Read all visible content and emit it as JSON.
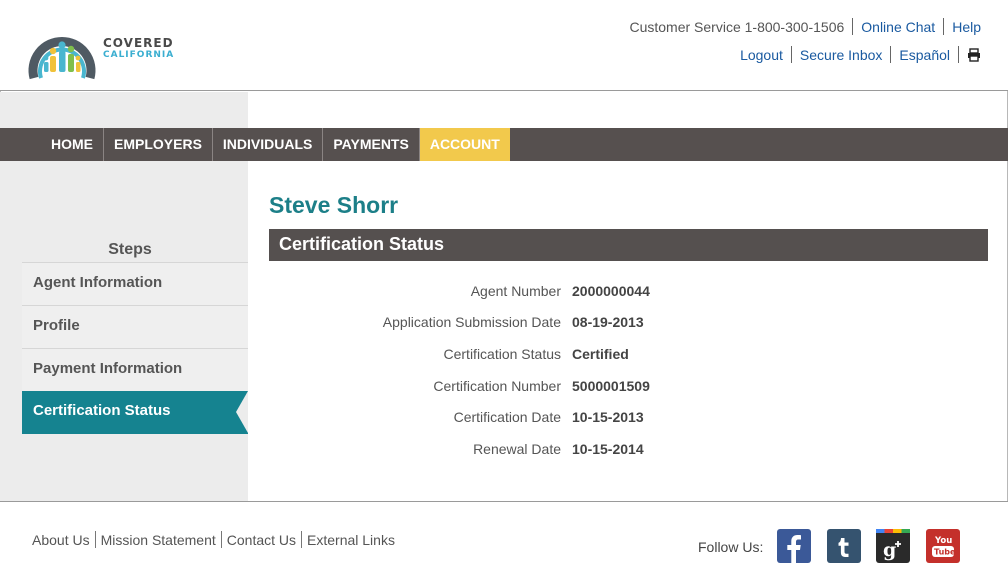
{
  "header": {
    "logo_line1": "COVERED",
    "logo_line2": "CALIFORNIA",
    "customer_service": "Customer Service 1-800-300-1506",
    "online_chat": "Online Chat",
    "help": "Help",
    "logout": "Logout",
    "secure_inbox": "Secure Inbox",
    "espanol": "Español",
    "print_icon": "printer-icon"
  },
  "nav": {
    "items": [
      {
        "label": "HOME"
      },
      {
        "label": "EMPLOYERS"
      },
      {
        "label": "INDIVIDUALS"
      },
      {
        "label": "PAYMENTS"
      },
      {
        "label": "ACCOUNT"
      }
    ],
    "active_index": 4,
    "active_color": "#f2c94c",
    "bar_color": "#56504f"
  },
  "sidebar": {
    "title": "Steps",
    "items": [
      {
        "label": "Agent Information"
      },
      {
        "label": "Profile"
      },
      {
        "label": "Payment Information"
      },
      {
        "label": "Certification Status"
      }
    ],
    "active_index": 3,
    "active_color": "#158390"
  },
  "main": {
    "name": "Steve Shorr",
    "section_title": "Certification Status",
    "fields": [
      {
        "label": "Agent Number",
        "value": "2000000044"
      },
      {
        "label": "Application Submission Date",
        "value": "08-19-2013"
      },
      {
        "label": "Certification Status",
        "value": "Certified"
      },
      {
        "label": "Certification Number",
        "value": "5000001509"
      },
      {
        "label": "Certification Date",
        "value": "10-15-2013"
      },
      {
        "label": "Renewal Date",
        "value": "10-15-2014"
      }
    ]
  },
  "footer": {
    "links": [
      {
        "label": "About Us"
      },
      {
        "label": "Mission Statement"
      },
      {
        "label": "Contact Us"
      },
      {
        "label": "External Links"
      }
    ],
    "follow_label": "Follow Us:",
    "social_icons": [
      "facebook-icon",
      "tumblr-icon",
      "google-plus-icon",
      "youtube-icon"
    ]
  }
}
